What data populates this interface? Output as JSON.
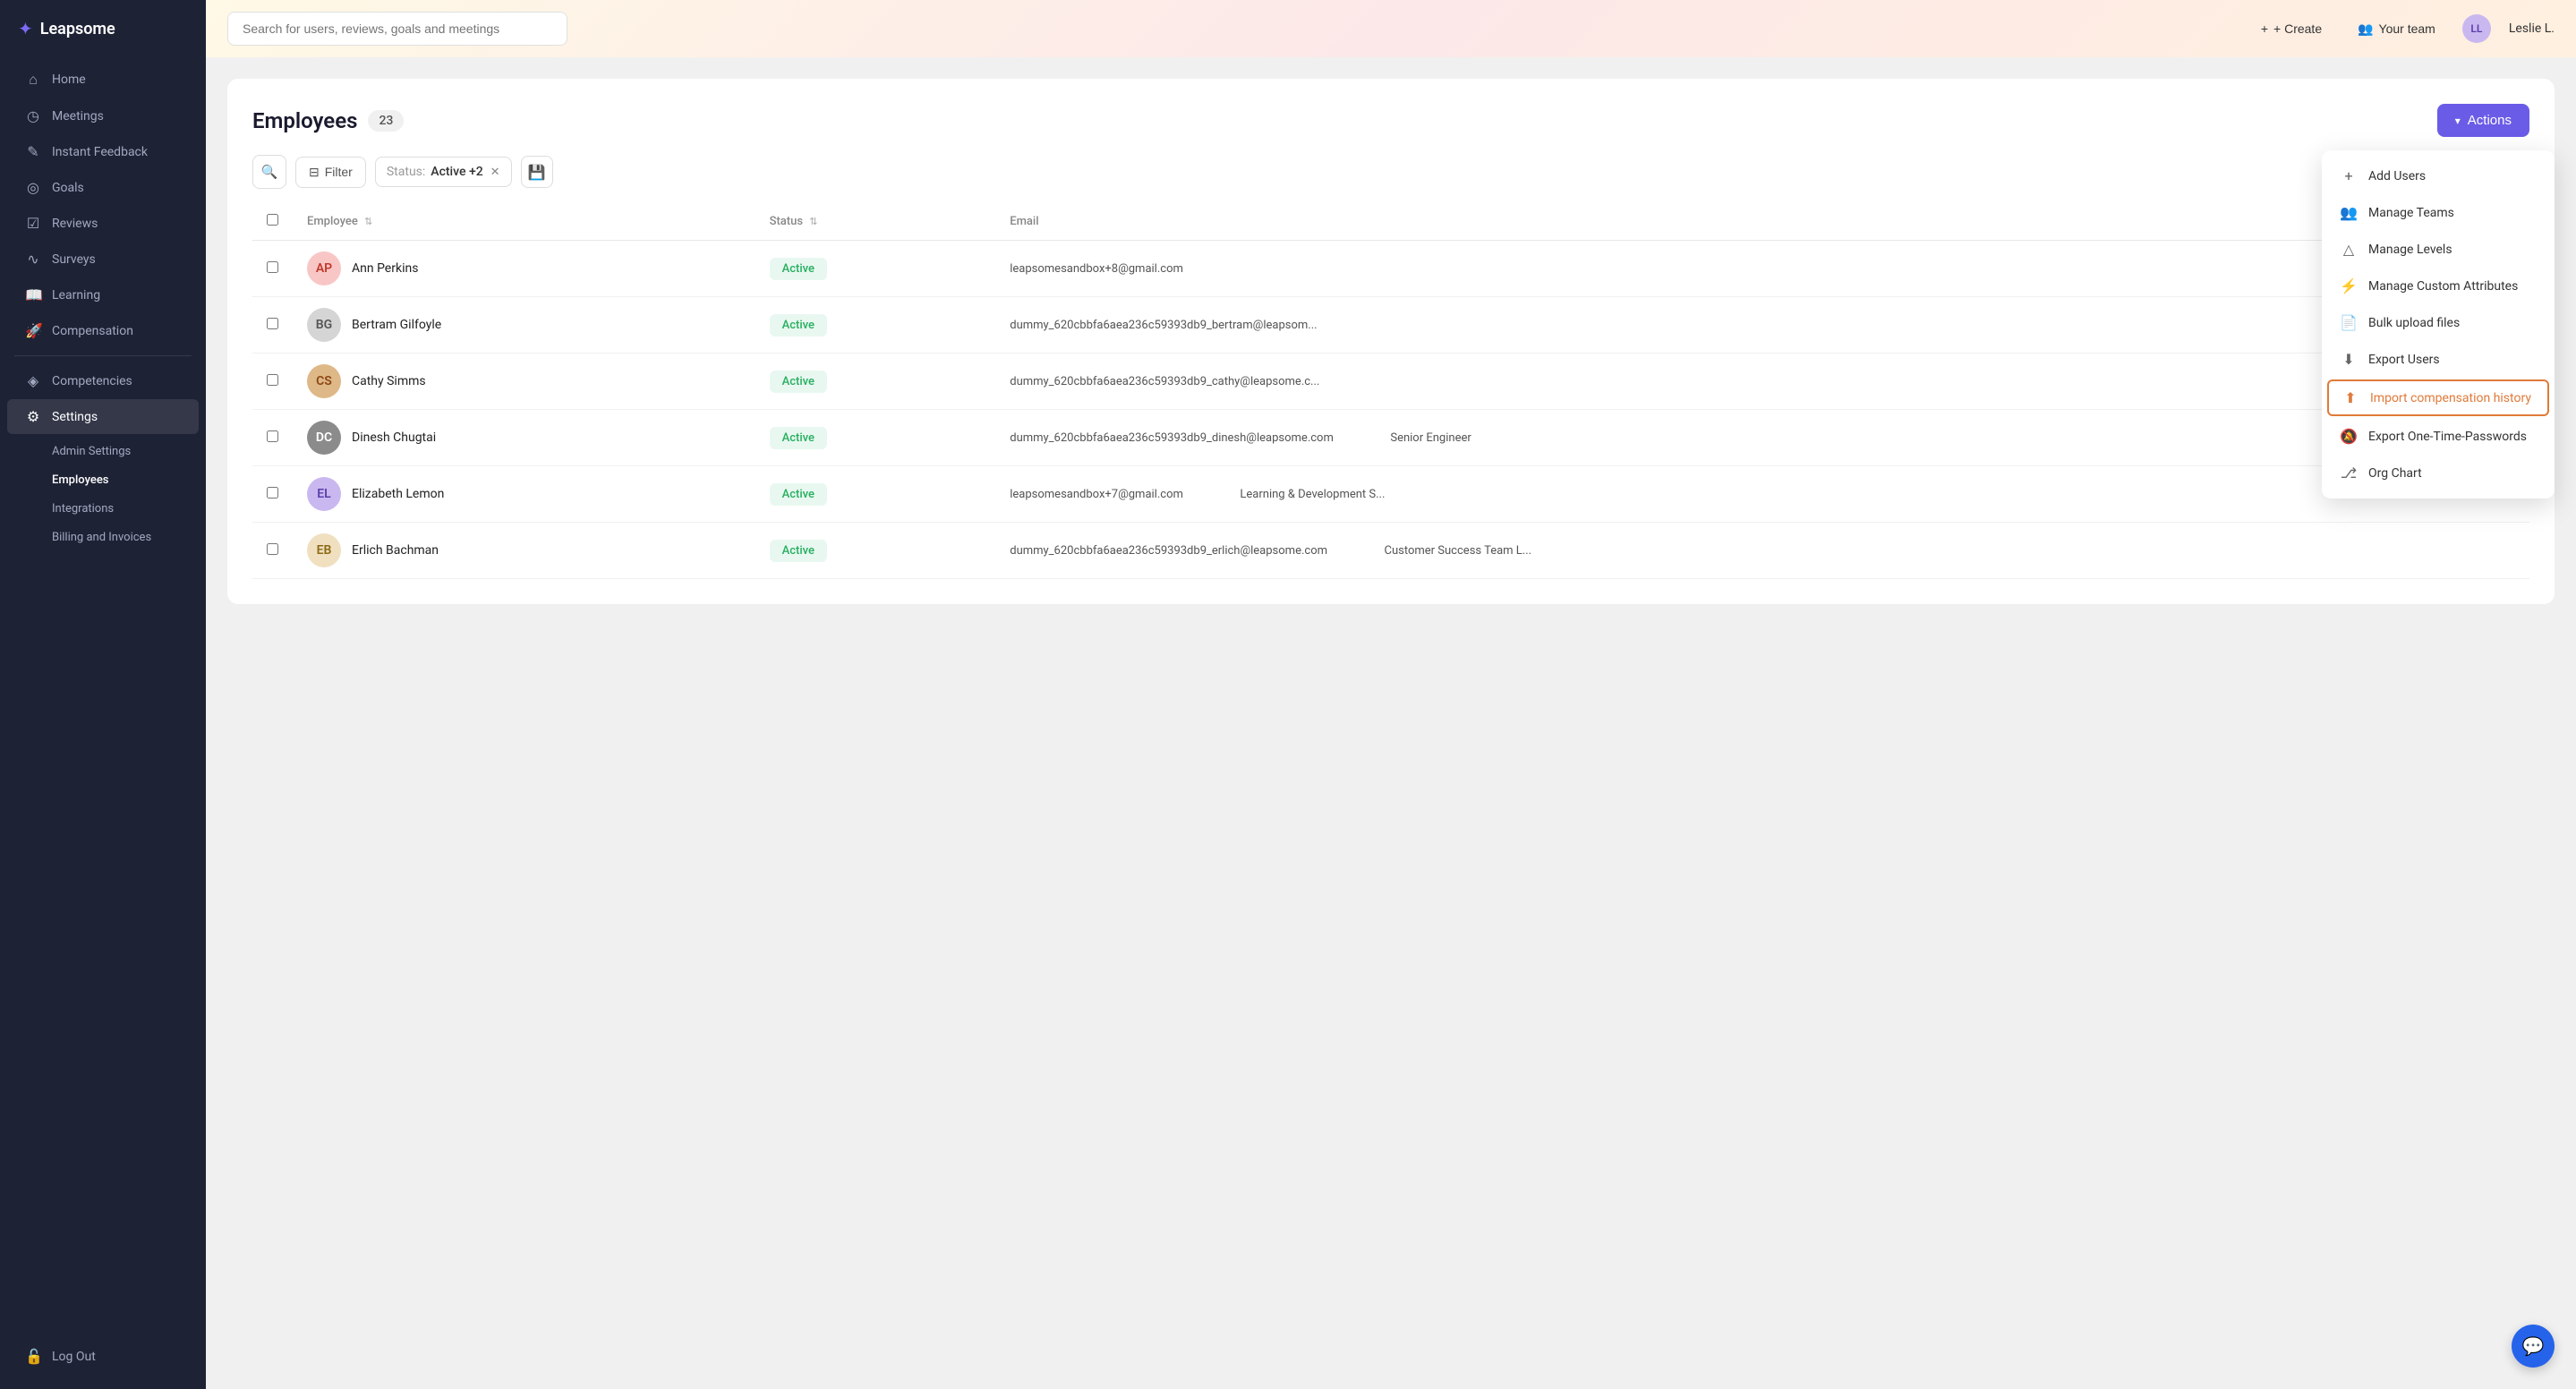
{
  "brand": {
    "name": "Leapsome",
    "logo_icon": "✦"
  },
  "sidebar": {
    "nav_items": [
      {
        "id": "home",
        "label": "Home",
        "icon": "⌂",
        "active": false
      },
      {
        "id": "meetings",
        "label": "Meetings",
        "icon": "◷",
        "active": false
      },
      {
        "id": "instant-feedback",
        "label": "Instant Feedback",
        "icon": "✎",
        "active": false
      },
      {
        "id": "goals",
        "label": "Goals",
        "icon": "◎",
        "active": false
      },
      {
        "id": "reviews",
        "label": "Reviews",
        "icon": "☑",
        "active": false
      },
      {
        "id": "surveys",
        "label": "Surveys",
        "icon": "∿",
        "active": false
      },
      {
        "id": "learning",
        "label": "Learning",
        "icon": "📖",
        "active": false
      },
      {
        "id": "compensation",
        "label": "Compensation",
        "icon": "🚀",
        "active": false
      }
    ],
    "divider": true,
    "bottom_nav_items": [
      {
        "id": "competencies",
        "label": "Competencies",
        "icon": "◈",
        "active": false
      },
      {
        "id": "settings",
        "label": "Settings",
        "icon": "⚙",
        "active": true
      }
    ],
    "sub_nav": [
      {
        "id": "admin-settings",
        "label": "Admin Settings",
        "active": false
      },
      {
        "id": "employees",
        "label": "Employees",
        "active": true
      },
      {
        "id": "integrations",
        "label": "Integrations",
        "active": false
      },
      {
        "id": "billing",
        "label": "Billing and Invoices",
        "active": false
      }
    ],
    "logout": "Log Out"
  },
  "topbar": {
    "search_placeholder": "Search for users, reviews, goals and meetings",
    "create_label": "+ Create",
    "your_team_label": "Your team",
    "user_label": "Leslie L.",
    "user_initials": "LL"
  },
  "page": {
    "title": "Employees",
    "count": "23",
    "actions_label": "Actions"
  },
  "filters": {
    "filter_label": "Filter",
    "status_filter": "Status: Active +2",
    "status_label": "Status:",
    "status_value": "Active +2"
  },
  "table": {
    "columns": [
      {
        "id": "employee",
        "label": "Employee",
        "sortable": true
      },
      {
        "id": "status",
        "label": "Status",
        "sortable": true
      },
      {
        "id": "email",
        "label": "Email",
        "sortable": false
      }
    ],
    "rows": [
      {
        "id": 1,
        "name": "Ann Perkins",
        "status": "Active",
        "email": "leapsomesandbox+8@gmail.com",
        "dept": "",
        "av_class": "av-pink",
        "initials": "AP"
      },
      {
        "id": 2,
        "name": "Bertram Gilfoyle",
        "status": "Active",
        "email": "dummy_620cbbfa6aea236c59393db9_bertram@leapsom...",
        "dept": "",
        "av_class": "av-gray",
        "initials": "BG"
      },
      {
        "id": 3,
        "name": "Cathy Simms",
        "status": "Active",
        "email": "dummy_620cbbfa6aea236c59393db9_cathy@leapsome.c...",
        "dept": "",
        "av_class": "av-brown",
        "initials": "CS"
      },
      {
        "id": 4,
        "name": "Dinesh Chugtai",
        "status": "Active",
        "email": "dummy_620cbbfa6aea236c59393db9_dinesh@leapsome.com",
        "dept": "Senior Engineer",
        "av_class": "av-dark",
        "initials": "DC"
      },
      {
        "id": 5,
        "name": "Elizabeth Lemon",
        "status": "Active",
        "email": "leapsomesandbox+7@gmail.com",
        "dept": "Learning & Development S...",
        "av_class": "av-purple",
        "initials": "EL"
      },
      {
        "id": 6,
        "name": "Erlich Bachman",
        "status": "Active",
        "email": "dummy_620cbbfa6aea236c59393db9_erlich@leapsome.com",
        "dept": "Customer Success Team L...",
        "av_class": "av-light",
        "initials": "EB"
      }
    ]
  },
  "dropdown": {
    "items": [
      {
        "id": "add-users",
        "label": "Add Users",
        "icon": "+"
      },
      {
        "id": "manage-teams",
        "label": "Manage Teams",
        "icon": "👥"
      },
      {
        "id": "manage-levels",
        "label": "Manage Levels",
        "icon": "△"
      },
      {
        "id": "manage-custom-attrs",
        "label": "Manage Custom Attributes",
        "icon": "⚡"
      },
      {
        "id": "bulk-upload",
        "label": "Bulk upload files",
        "icon": "📄"
      },
      {
        "id": "export-users",
        "label": "Export Users",
        "icon": "⬇"
      },
      {
        "id": "import-compensation",
        "label": "Import compensation history",
        "icon": "⬆",
        "highlighted": true
      },
      {
        "id": "export-passwords",
        "label": "Export One-Time-Passwords",
        "icon": "🔕"
      },
      {
        "id": "org-chart",
        "label": "Org Chart",
        "icon": "⎇"
      }
    ]
  }
}
